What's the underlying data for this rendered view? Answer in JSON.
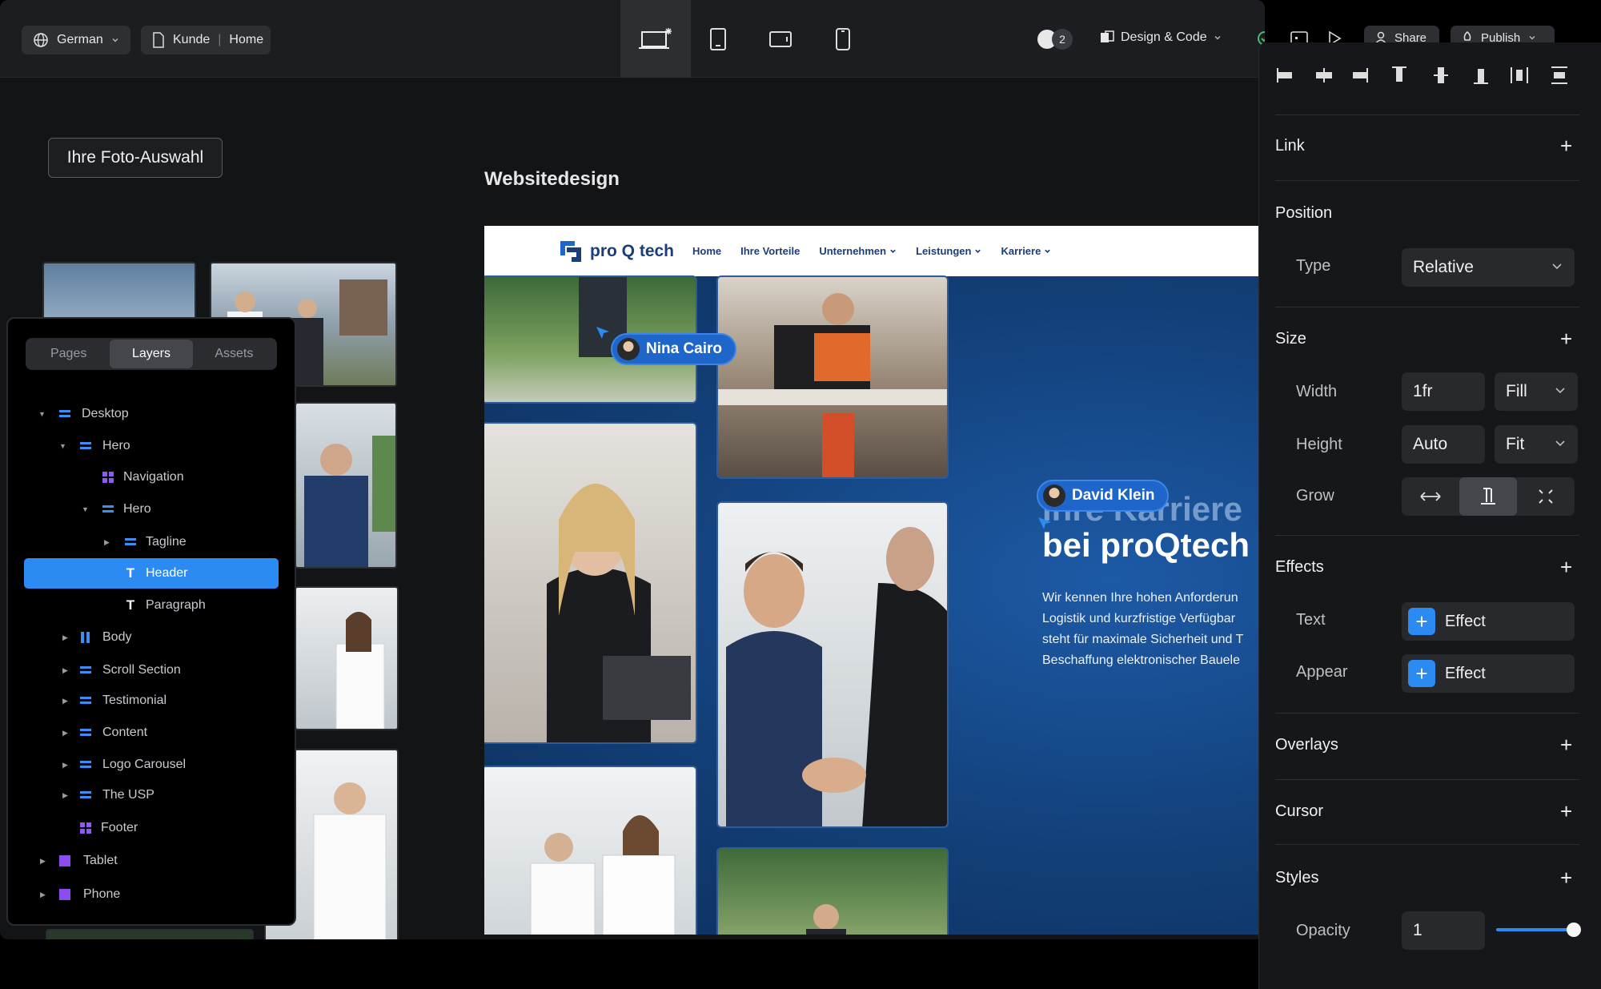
{
  "topbar": {
    "language": "German",
    "page_parent": "Kunde",
    "page_name": "Home",
    "collaborators_count": "2",
    "mode": "Design & Code",
    "share_label": "Share",
    "publish_label": "Publish"
  },
  "stage": {
    "photo_group_label": "Ihre Foto-Auswahl",
    "section_title": "Websitedesign"
  },
  "site": {
    "logo_text": "pro Q tech",
    "nav": [
      "Home",
      "Ihre Vorteile",
      "Unternehmen",
      "Leistungen",
      "Karriere"
    ],
    "heading_partial": "Ihre Karriere",
    "heading": "bei proQtech",
    "paragraph": [
      "Wir kennen Ihre hohen Anforderun",
      "Logistik und kurzfristige Verfügbar",
      "steht für maximale Sicherheit und T",
      "Beschaffung elektronischer Bauele"
    ]
  },
  "cursors": {
    "nina": "Nina Cairo",
    "david": "David Klein"
  },
  "layers_panel": {
    "tabs": [
      "Pages",
      "Layers",
      "Assets"
    ],
    "active_tab": "Layers",
    "items": [
      {
        "label": "Desktop",
        "icon": "stack-icon"
      },
      {
        "label": "Hero",
        "icon": "stack-icon"
      },
      {
        "label": "Navigation",
        "icon": "component-icon"
      },
      {
        "label": "Hero",
        "icon": "stack-icon"
      },
      {
        "label": "Tagline",
        "icon": "stack-icon"
      },
      {
        "label": "Header",
        "icon": "text-icon",
        "selected": true
      },
      {
        "label": "Paragraph",
        "icon": "text-icon"
      },
      {
        "label": "Body",
        "icon": "columns-icon"
      },
      {
        "label": "Scroll Section",
        "icon": "stack-icon"
      },
      {
        "label": "Testimonial",
        "icon": "stack-icon"
      },
      {
        "label": "Content",
        "icon": "stack-icon"
      },
      {
        "label": "Logo Carousel",
        "icon": "stack-icon"
      },
      {
        "label": "The USP",
        "icon": "stack-icon"
      },
      {
        "label": "Footer",
        "icon": "component-icon"
      },
      {
        "label": "Tablet",
        "icon": "frame-icon"
      },
      {
        "label": "Phone",
        "icon": "frame-icon"
      }
    ]
  },
  "inspector": {
    "link": "Link",
    "position": {
      "title": "Position",
      "type_label": "Type",
      "type_value": "Relative"
    },
    "size": {
      "title": "Size",
      "width_label": "Width",
      "width_value": "1fr",
      "width_mode": "Fill",
      "height_label": "Height",
      "height_value": "Auto",
      "height_mode": "Fit",
      "grow_label": "Grow"
    },
    "effects": {
      "title": "Effects",
      "text_label": "Text",
      "appear_label": "Appear",
      "effect_label": "Effect"
    },
    "overlays": "Overlays",
    "cursor": "Cursor",
    "styles": {
      "title": "Styles",
      "opacity_label": "Opacity",
      "opacity_value": "1"
    }
  },
  "colors": {
    "accent": "#2b8bf2",
    "site_blue": "#123f78",
    "panel": "#16171a"
  }
}
